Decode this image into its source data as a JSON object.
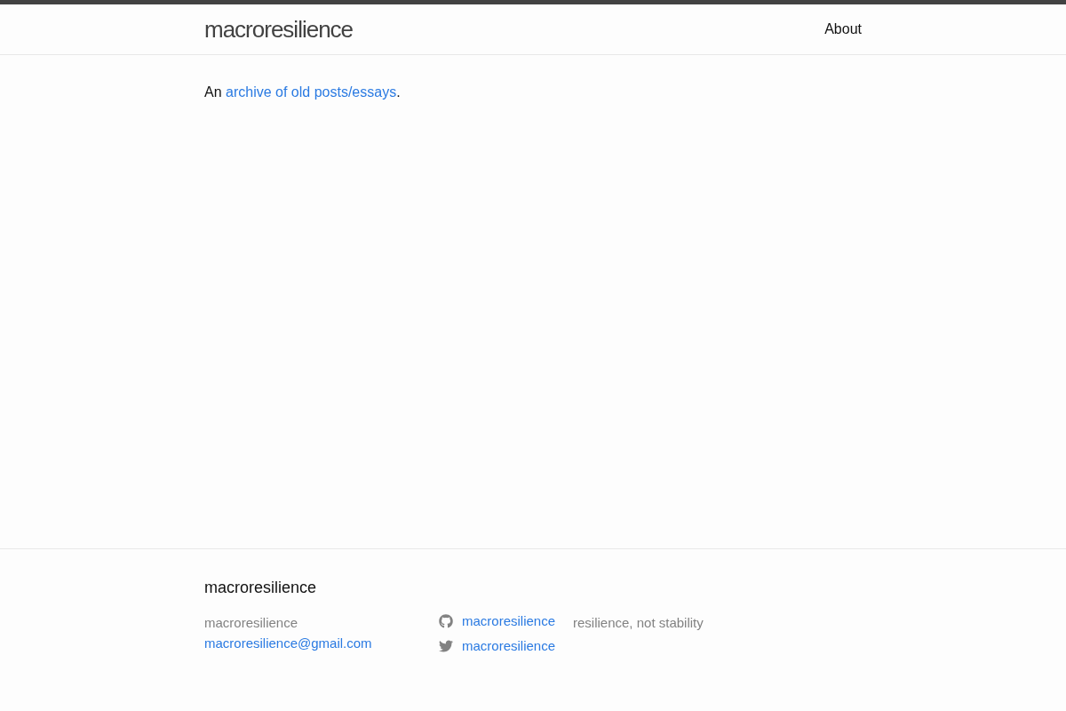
{
  "header": {
    "site_title": "macroresilience",
    "nav": [
      {
        "label": "About"
      }
    ]
  },
  "main": {
    "intro": [
      {
        "kind": "text",
        "text": "An"
      },
      {
        "kind": "link",
        "text": "archive of old posts/essays"
      },
      {
        "kind": "text",
        "text": "."
      }
    ]
  },
  "footer": {
    "heading": "macroresilience",
    "contact": {
      "name": "macroresilience",
      "email": "macroresilience@gmail.com"
    },
    "social": [
      {
        "kind": "github",
        "username": "macroresilience"
      },
      {
        "kind": "twitter",
        "username": "macroresilience"
      }
    ],
    "description": "resilience, not stability"
  }
}
